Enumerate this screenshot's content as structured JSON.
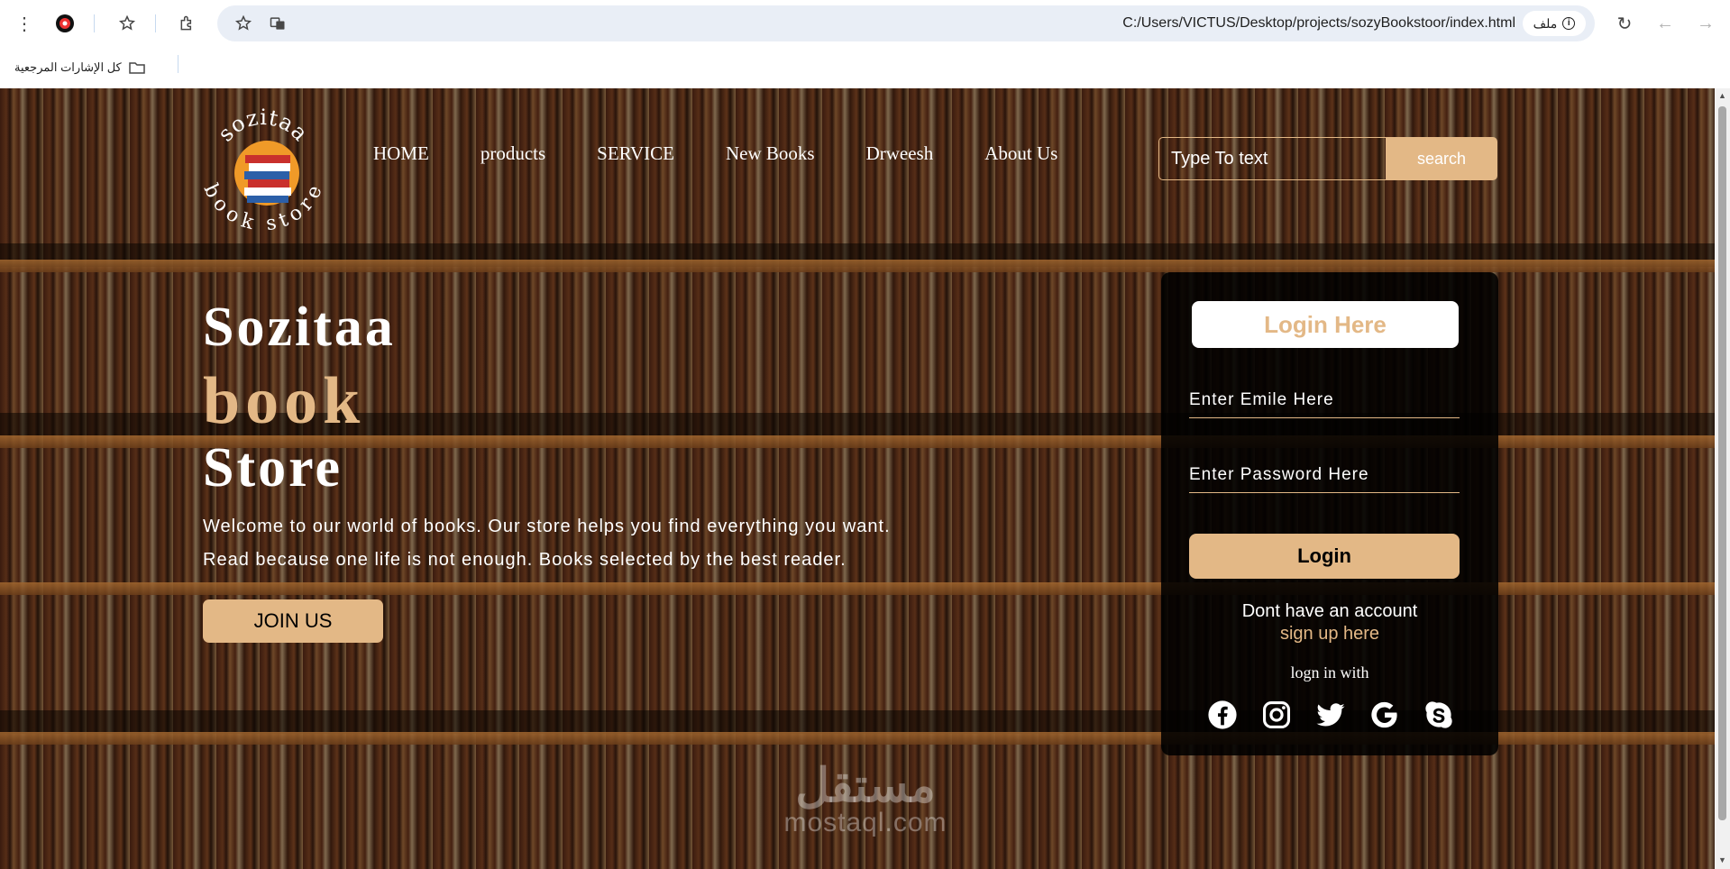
{
  "browser": {
    "url": "C:/Users/VICTUS/Desktop/projects/sozyBookstoor/index.html",
    "file_chip": "ملف",
    "bookmarks_label": "كل الإشارات المرجعية"
  },
  "site": {
    "logo_top": "sozitaa",
    "logo_bottom": "book store",
    "nav": [
      "HOME",
      "products",
      "SERVICE",
      "New Books",
      "Drweesh",
      "About Us"
    ],
    "search_placeholder": "Type To text",
    "search_button": "search",
    "hero": {
      "line1": "Sozitaa",
      "line2": "book",
      "line3": "Store",
      "desc1": "Welcome to our world of books. Our store helps you find everything you want.",
      "desc2": "Read because one life is not enough. Books selected by the best reader.",
      "join": "JOIN US"
    },
    "login": {
      "title": "Login Here",
      "email_placeholder": "Enter Emile Here",
      "password_placeholder": "Enter Password Here",
      "button": "Login",
      "no_account": "Dont have an account",
      "signup": "sign up here",
      "login_with": "logn in with",
      "socials": [
        "facebook-icon",
        "instagram-icon",
        "twitter-icon",
        "google-icon",
        "skype-icon"
      ]
    },
    "watermark": {
      "arabic": "مستقل",
      "latin": "mostaql.com"
    }
  },
  "colors": {
    "accent": "#e3b886",
    "card": "#000000"
  }
}
